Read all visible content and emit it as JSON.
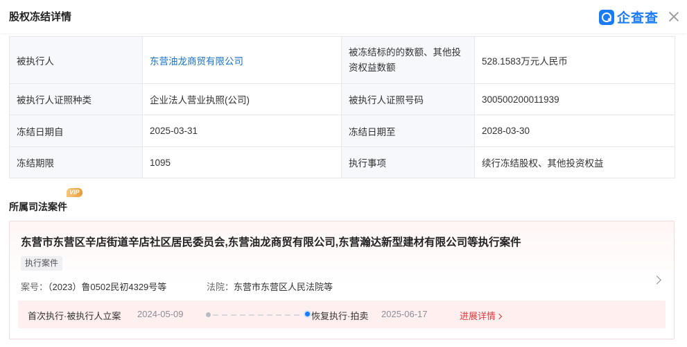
{
  "header": {
    "title": "股权冻结详情",
    "logo_text": "企查查",
    "logo_color": "#1b7bf5",
    "icons": {
      "logo": "qichacha-logo-icon",
      "close": "close-icon"
    }
  },
  "freeze_details": [
    {
      "label": "被执行人",
      "value": "东营油龙商贸有限公司",
      "value_is_link": true,
      "label2": "被冻结标的的数额、其他投资权益数额",
      "value2": "528.1583万元人民币"
    },
    {
      "label": "被执行人证照种类",
      "value": "企业法人营业执照(公司)",
      "label2": "被执行人证照号码",
      "value2": "300500200011939"
    },
    {
      "label": "冻结日期自",
      "value": "2025-03-31",
      "label2": "冻结日期至",
      "value2": "2028-03-30"
    },
    {
      "label": "冻结期限",
      "value": "1095",
      "label2": "执行事项",
      "value2": "续行冻结股权、其他投资权益"
    }
  ],
  "judicial_section": {
    "title": "所属司法案件",
    "vip_badge": "VIP",
    "case": {
      "title": "东营市东营区辛店街道辛店社区居民委员会,东营油龙商贸有限公司,东营瀚达新型建材有限公司等执行案件",
      "tag": "执行案件",
      "case_no_label": "案号：",
      "case_no": "（2023）鲁0502民初4329号等",
      "court_label": "法院：",
      "court": "东营市东营区人民法院等",
      "timeline": {
        "step1_label": "首次执行·被执行人立案",
        "step1_date": "2024-05-09",
        "step2_label": "恢复执行·拍卖",
        "step2_date": "2025-06-17",
        "detail_link": "进展详情"
      }
    }
  },
  "colors": {
    "accent": "#1b7bf5",
    "link": "#1a73c9",
    "highlight": "#e0373e"
  }
}
